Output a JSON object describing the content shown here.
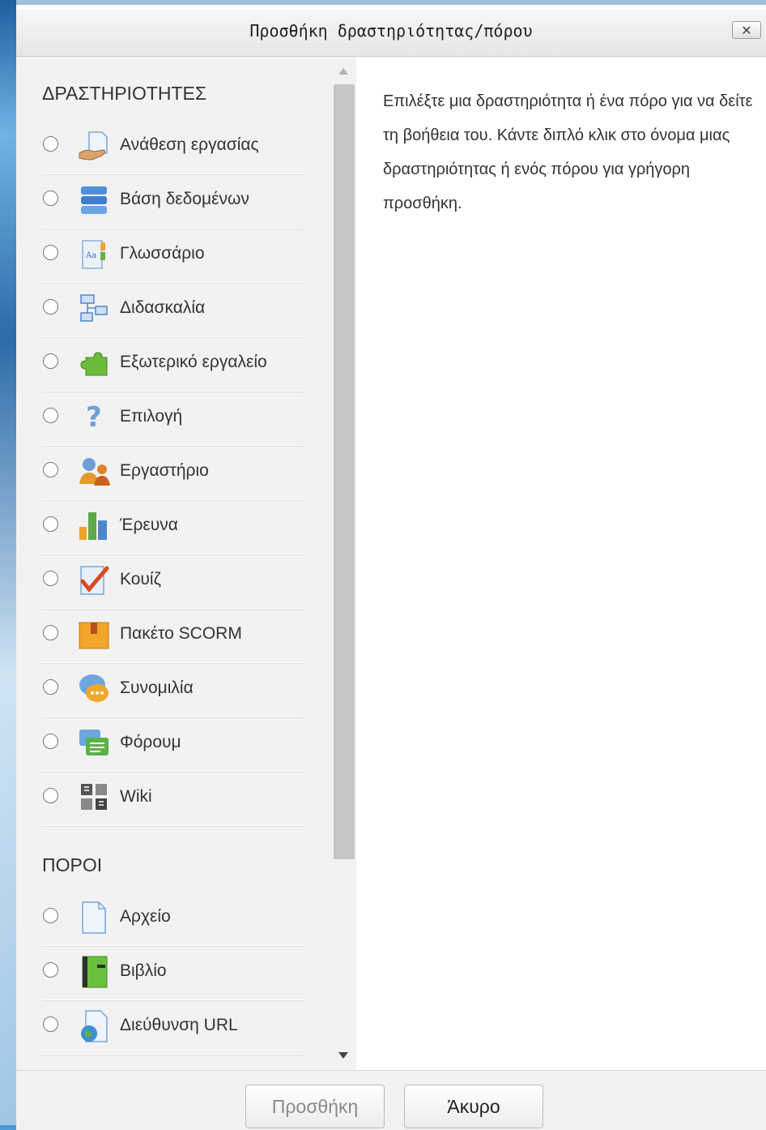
{
  "dialog": {
    "title": "Προσθήκη δραστηριότητας/πόρου",
    "close_label": "✕"
  },
  "activities": {
    "heading": "ΔΡΑΣΤΗΡΙΟΤΗΤΕΣ",
    "items": [
      {
        "label": "Ανάθεση εργασίας",
        "icon": "assignment-icon"
      },
      {
        "label": "Βάση δεδομένων",
        "icon": "database-icon"
      },
      {
        "label": "Γλωσσάριο",
        "icon": "glossary-icon"
      },
      {
        "label": "Διδασκαλία",
        "icon": "lesson-icon"
      },
      {
        "label": "Εξωτερικό εργαλείο",
        "icon": "external-tool-icon"
      },
      {
        "label": "Επιλογή",
        "icon": "choice-icon"
      },
      {
        "label": "Εργαστήριο",
        "icon": "workshop-icon"
      },
      {
        "label": "Έρευνα",
        "icon": "survey-icon"
      },
      {
        "label": "Κουίζ",
        "icon": "quiz-icon"
      },
      {
        "label": "Πακέτο SCORM",
        "icon": "scorm-icon"
      },
      {
        "label": "Συνομιλία",
        "icon": "chat-icon"
      },
      {
        "label": "Φόρουμ",
        "icon": "forum-icon"
      },
      {
        "label": "Wiki",
        "icon": "wiki-icon"
      }
    ]
  },
  "resources": {
    "heading": "ΠΟΡΟΙ",
    "items": [
      {
        "label": "Αρχείο",
        "icon": "file-icon"
      },
      {
        "label": "Βιβλίο",
        "icon": "book-icon"
      },
      {
        "label": "Διεύθυνση URL",
        "icon": "url-icon"
      }
    ]
  },
  "help": {
    "text": "Επιλέξτε μια δραστηριότητα ή ένα πόρο για να δείτε τη βοήθεια του. Κάντε διπλό κλικ στο όνομα μιας δραστηριότητας ή ενός πόρου για γρήγορη προσθήκη."
  },
  "footer": {
    "add_label": "Προσθήκη",
    "cancel_label": "Άκυρο"
  }
}
